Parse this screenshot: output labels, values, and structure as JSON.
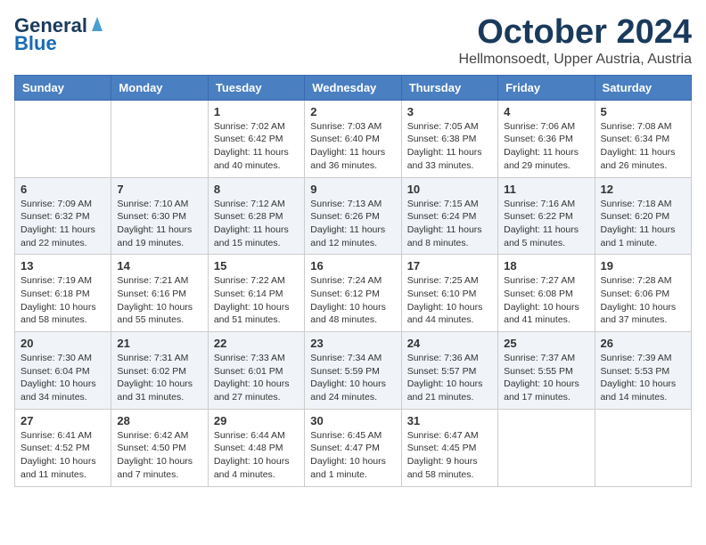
{
  "header": {
    "logo_general": "General",
    "logo_blue": "Blue",
    "month_title": "October 2024",
    "subtitle": "Hellmonsoedt, Upper Austria, Austria"
  },
  "weekdays": [
    "Sunday",
    "Monday",
    "Tuesday",
    "Wednesday",
    "Thursday",
    "Friday",
    "Saturday"
  ],
  "weeks": [
    [
      {
        "day": "",
        "sunrise": "",
        "sunset": "",
        "daylight": ""
      },
      {
        "day": "",
        "sunrise": "",
        "sunset": "",
        "daylight": ""
      },
      {
        "day": "1",
        "sunrise": "Sunrise: 7:02 AM",
        "sunset": "Sunset: 6:42 PM",
        "daylight": "Daylight: 11 hours and 40 minutes."
      },
      {
        "day": "2",
        "sunrise": "Sunrise: 7:03 AM",
        "sunset": "Sunset: 6:40 PM",
        "daylight": "Daylight: 11 hours and 36 minutes."
      },
      {
        "day": "3",
        "sunrise": "Sunrise: 7:05 AM",
        "sunset": "Sunset: 6:38 PM",
        "daylight": "Daylight: 11 hours and 33 minutes."
      },
      {
        "day": "4",
        "sunrise": "Sunrise: 7:06 AM",
        "sunset": "Sunset: 6:36 PM",
        "daylight": "Daylight: 11 hours and 29 minutes."
      },
      {
        "day": "5",
        "sunrise": "Sunrise: 7:08 AM",
        "sunset": "Sunset: 6:34 PM",
        "daylight": "Daylight: 11 hours and 26 minutes."
      }
    ],
    [
      {
        "day": "6",
        "sunrise": "Sunrise: 7:09 AM",
        "sunset": "Sunset: 6:32 PM",
        "daylight": "Daylight: 11 hours and 22 minutes."
      },
      {
        "day": "7",
        "sunrise": "Sunrise: 7:10 AM",
        "sunset": "Sunset: 6:30 PM",
        "daylight": "Daylight: 11 hours and 19 minutes."
      },
      {
        "day": "8",
        "sunrise": "Sunrise: 7:12 AM",
        "sunset": "Sunset: 6:28 PM",
        "daylight": "Daylight: 11 hours and 15 minutes."
      },
      {
        "day": "9",
        "sunrise": "Sunrise: 7:13 AM",
        "sunset": "Sunset: 6:26 PM",
        "daylight": "Daylight: 11 hours and 12 minutes."
      },
      {
        "day": "10",
        "sunrise": "Sunrise: 7:15 AM",
        "sunset": "Sunset: 6:24 PM",
        "daylight": "Daylight: 11 hours and 8 minutes."
      },
      {
        "day": "11",
        "sunrise": "Sunrise: 7:16 AM",
        "sunset": "Sunset: 6:22 PM",
        "daylight": "Daylight: 11 hours and 5 minutes."
      },
      {
        "day": "12",
        "sunrise": "Sunrise: 7:18 AM",
        "sunset": "Sunset: 6:20 PM",
        "daylight": "Daylight: 11 hours and 1 minute."
      }
    ],
    [
      {
        "day": "13",
        "sunrise": "Sunrise: 7:19 AM",
        "sunset": "Sunset: 6:18 PM",
        "daylight": "Daylight: 10 hours and 58 minutes."
      },
      {
        "day": "14",
        "sunrise": "Sunrise: 7:21 AM",
        "sunset": "Sunset: 6:16 PM",
        "daylight": "Daylight: 10 hours and 55 minutes."
      },
      {
        "day": "15",
        "sunrise": "Sunrise: 7:22 AM",
        "sunset": "Sunset: 6:14 PM",
        "daylight": "Daylight: 10 hours and 51 minutes."
      },
      {
        "day": "16",
        "sunrise": "Sunrise: 7:24 AM",
        "sunset": "Sunset: 6:12 PM",
        "daylight": "Daylight: 10 hours and 48 minutes."
      },
      {
        "day": "17",
        "sunrise": "Sunrise: 7:25 AM",
        "sunset": "Sunset: 6:10 PM",
        "daylight": "Daylight: 10 hours and 44 minutes."
      },
      {
        "day": "18",
        "sunrise": "Sunrise: 7:27 AM",
        "sunset": "Sunset: 6:08 PM",
        "daylight": "Daylight: 10 hours and 41 minutes."
      },
      {
        "day": "19",
        "sunrise": "Sunrise: 7:28 AM",
        "sunset": "Sunset: 6:06 PM",
        "daylight": "Daylight: 10 hours and 37 minutes."
      }
    ],
    [
      {
        "day": "20",
        "sunrise": "Sunrise: 7:30 AM",
        "sunset": "Sunset: 6:04 PM",
        "daylight": "Daylight: 10 hours and 34 minutes."
      },
      {
        "day": "21",
        "sunrise": "Sunrise: 7:31 AM",
        "sunset": "Sunset: 6:02 PM",
        "daylight": "Daylight: 10 hours and 31 minutes."
      },
      {
        "day": "22",
        "sunrise": "Sunrise: 7:33 AM",
        "sunset": "Sunset: 6:01 PM",
        "daylight": "Daylight: 10 hours and 27 minutes."
      },
      {
        "day": "23",
        "sunrise": "Sunrise: 7:34 AM",
        "sunset": "Sunset: 5:59 PM",
        "daylight": "Daylight: 10 hours and 24 minutes."
      },
      {
        "day": "24",
        "sunrise": "Sunrise: 7:36 AM",
        "sunset": "Sunset: 5:57 PM",
        "daylight": "Daylight: 10 hours and 21 minutes."
      },
      {
        "day": "25",
        "sunrise": "Sunrise: 7:37 AM",
        "sunset": "Sunset: 5:55 PM",
        "daylight": "Daylight: 10 hours and 17 minutes."
      },
      {
        "day": "26",
        "sunrise": "Sunrise: 7:39 AM",
        "sunset": "Sunset: 5:53 PM",
        "daylight": "Daylight: 10 hours and 14 minutes."
      }
    ],
    [
      {
        "day": "27",
        "sunrise": "Sunrise: 6:41 AM",
        "sunset": "Sunset: 4:52 PM",
        "daylight": "Daylight: 10 hours and 11 minutes."
      },
      {
        "day": "28",
        "sunrise": "Sunrise: 6:42 AM",
        "sunset": "Sunset: 4:50 PM",
        "daylight": "Daylight: 10 hours and 7 minutes."
      },
      {
        "day": "29",
        "sunrise": "Sunrise: 6:44 AM",
        "sunset": "Sunset: 4:48 PM",
        "daylight": "Daylight: 10 hours and 4 minutes."
      },
      {
        "day": "30",
        "sunrise": "Sunrise: 6:45 AM",
        "sunset": "Sunset: 4:47 PM",
        "daylight": "Daylight: 10 hours and 1 minute."
      },
      {
        "day": "31",
        "sunrise": "Sunrise: 6:47 AM",
        "sunset": "Sunset: 4:45 PM",
        "daylight": "Daylight: 9 hours and 58 minutes."
      },
      {
        "day": "",
        "sunrise": "",
        "sunset": "",
        "daylight": ""
      },
      {
        "day": "",
        "sunrise": "",
        "sunset": "",
        "daylight": ""
      }
    ]
  ]
}
